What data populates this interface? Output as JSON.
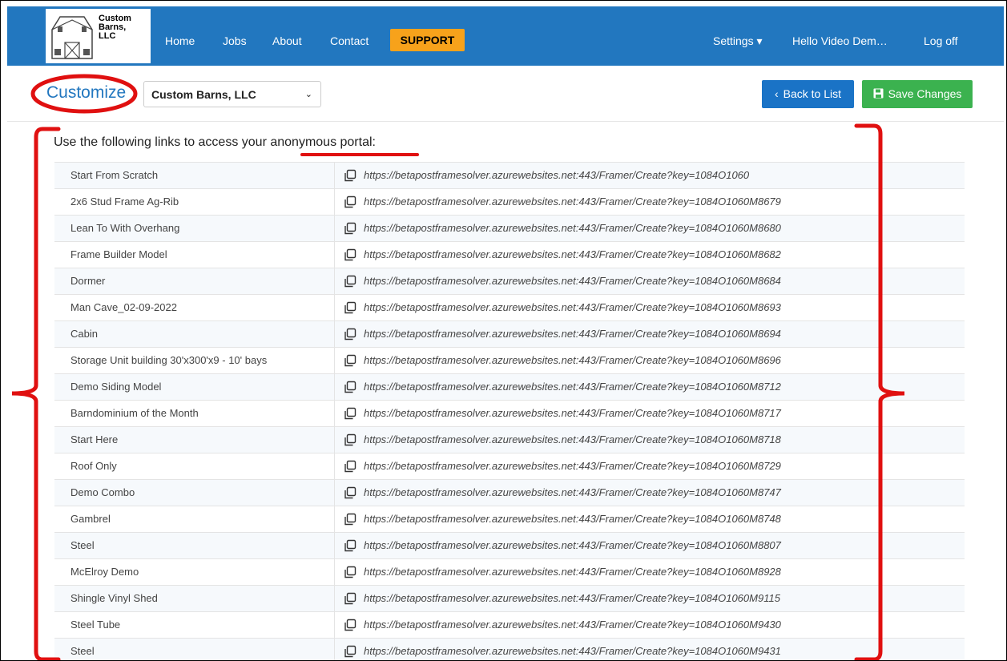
{
  "navbar": {
    "logo_text": [
      "Custom",
      "Barns,",
      "LLC"
    ],
    "links": [
      "Home",
      "Jobs",
      "About",
      "Contact"
    ],
    "support_label": "SUPPORT",
    "settings_label": "Settings ▾",
    "user_label": "Hello Video Dem…",
    "logoff_label": "Log off"
  },
  "header": {
    "title": "Customize",
    "company_select_value": "Custom Barns, LLC",
    "back_label": "Back to List",
    "save_label": "Save Changes"
  },
  "content": {
    "intro_prefix": "Use the following links to access your ",
    "intro_highlight": "anonymous portal",
    "intro_suffix": ":",
    "rows": [
      {
        "name": "Start From Scratch",
        "url": "https://betapostframesolver.azurewebsites.net:443/Framer/Create?key=1084O1060"
      },
      {
        "name": "2x6 Stud Frame Ag-Rib",
        "url": "https://betapostframesolver.azurewebsites.net:443/Framer/Create?key=1084O1060M8679"
      },
      {
        "name": "Lean To With Overhang",
        "url": "https://betapostframesolver.azurewebsites.net:443/Framer/Create?key=1084O1060M8680"
      },
      {
        "name": "Frame Builder Model",
        "url": "https://betapostframesolver.azurewebsites.net:443/Framer/Create?key=1084O1060M8682"
      },
      {
        "name": "Dormer",
        "url": "https://betapostframesolver.azurewebsites.net:443/Framer/Create?key=1084O1060M8684"
      },
      {
        "name": "Man Cave_02-09-2022",
        "url": "https://betapostframesolver.azurewebsites.net:443/Framer/Create?key=1084O1060M8693"
      },
      {
        "name": "Cabin",
        "url": "https://betapostframesolver.azurewebsites.net:443/Framer/Create?key=1084O1060M8694"
      },
      {
        "name": "Storage Unit building 30'x300'x9 - 10' bays",
        "url": "https://betapostframesolver.azurewebsites.net:443/Framer/Create?key=1084O1060M8696"
      },
      {
        "name": "Demo Siding Model",
        "url": "https://betapostframesolver.azurewebsites.net:443/Framer/Create?key=1084O1060M8712"
      },
      {
        "name": "Barndominium of the Month",
        "url": "https://betapostframesolver.azurewebsites.net:443/Framer/Create?key=1084O1060M8717"
      },
      {
        "name": "Start Here",
        "url": "https://betapostframesolver.azurewebsites.net:443/Framer/Create?key=1084O1060M8718"
      },
      {
        "name": "Roof Only",
        "url": "https://betapostframesolver.azurewebsites.net:443/Framer/Create?key=1084O1060M8729"
      },
      {
        "name": "Demo Combo",
        "url": "https://betapostframesolver.azurewebsites.net:443/Framer/Create?key=1084O1060M8747"
      },
      {
        "name": "Gambrel",
        "url": "https://betapostframesolver.azurewebsites.net:443/Framer/Create?key=1084O1060M8748"
      },
      {
        "name": "Steel",
        "url": "https://betapostframesolver.azurewebsites.net:443/Framer/Create?key=1084O1060M8807"
      },
      {
        "name": "McElroy Demo",
        "url": "https://betapostframesolver.azurewebsites.net:443/Framer/Create?key=1084O1060M8928"
      },
      {
        "name": "Shingle Vinyl Shed",
        "url": "https://betapostframesolver.azurewebsites.net:443/Framer/Create?key=1084O1060M9115"
      },
      {
        "name": "Steel Tube",
        "url": "https://betapostframesolver.azurewebsites.net:443/Framer/Create?key=1084O1060M9430"
      },
      {
        "name": "Steel",
        "url": "https://betapostframesolver.azurewebsites.net:443/Framer/Create?key=1084O1060M9431"
      }
    ]
  },
  "colors": {
    "navbar": "#2277bf",
    "support": "#f7a21b",
    "back_button": "#1a73c6",
    "save_button": "#3bb24f",
    "annotation": "#e01010"
  },
  "icons": {
    "copy": "copy-icon",
    "back": "chevron-left-icon",
    "save": "floppy-disk-icon",
    "logo": "barn-logo-icon"
  }
}
